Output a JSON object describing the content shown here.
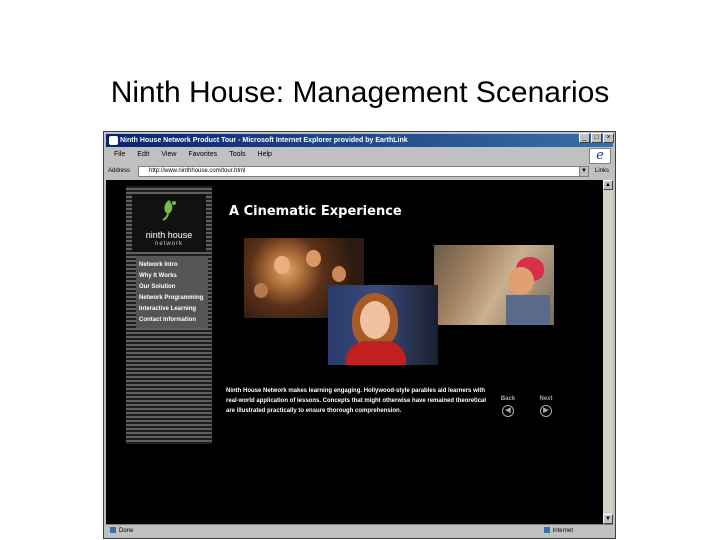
{
  "slide": {
    "title": "Ninth House: Management Scenarios"
  },
  "browser": {
    "title": "Ninth House Network Product Tour - Microsoft Internet Explorer provided by EarthLink",
    "controls": [
      "_",
      "□",
      "×"
    ],
    "menu": [
      "File",
      "Edit",
      "View",
      "Favorites",
      "Tools",
      "Help"
    ],
    "address_label": "Address",
    "address_value": "http://www.ninthhouse.com/tour.html",
    "links_label": "Links",
    "status_left": "Done",
    "status_right": "Internet"
  },
  "site": {
    "logo_name": "ninth house",
    "logo_sub": "network",
    "nav": [
      "Network Intro",
      "Why It Works",
      "Our Solution",
      "Network Programming",
      "Interactive Learning",
      "Contact Information"
    ],
    "heading": "A Cinematic Experience",
    "description": "Ninth House Network makes learning engaging. Hollywood-style parables aid learners with real-world application of lessons. Concepts that might otherwise have remained theoretical are illustrated practically to ensure thorough comprehension.",
    "back_label": "Back",
    "next_label": "Next"
  },
  "colors": {
    "accent_green": "#7ab648",
    "title_bar": "#0a246a"
  }
}
